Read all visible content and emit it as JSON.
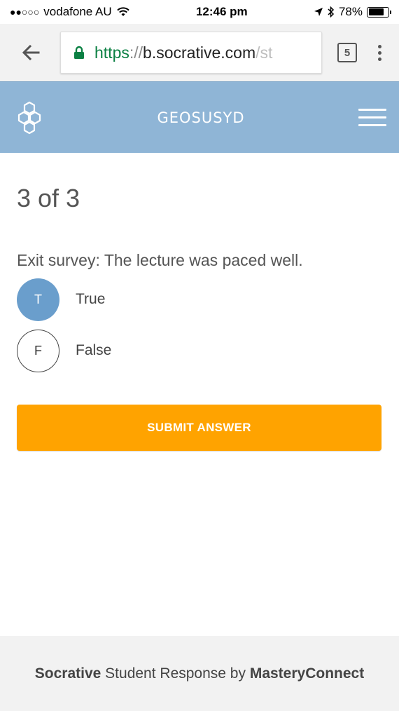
{
  "status_bar": {
    "signal": "●●○○○",
    "carrier": "vodafone AU",
    "time": "12:46 pm",
    "battery": "78%",
    "battery_level": 0.78
  },
  "browser": {
    "url_scheme": "https",
    "url_separator": "://",
    "url_host": "b.socrative.com",
    "url_path": "/st",
    "tab_count": "5"
  },
  "header": {
    "room_name": "GEOSUSYD"
  },
  "quiz": {
    "progress": "3 of 3",
    "question": "Exit survey: The lecture was paced well.",
    "answers": [
      {
        "letter": "T",
        "label": "True",
        "selected": true
      },
      {
        "letter": "F",
        "label": "False",
        "selected": false
      }
    ],
    "submit_label": "SUBMIT ANSWER"
  },
  "footer": {
    "brand": "Socrative",
    "middle": " Student Response by ",
    "company": "MasteryConnect"
  },
  "colors": {
    "header_bg": "#8fb5d6",
    "selected_answer": "#6a9ecc",
    "submit_button": "#ffa300",
    "url_secure": "#0b8043"
  }
}
